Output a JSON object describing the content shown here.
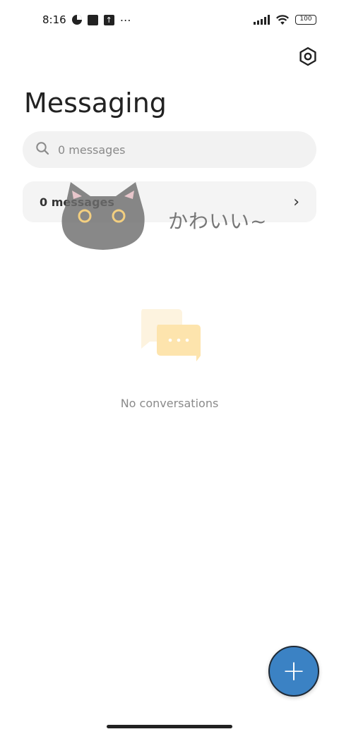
{
  "status_bar": {
    "time": "8:16",
    "battery": "100",
    "more_icon": "⋯"
  },
  "header": {
    "title": "Messaging",
    "settings_icon": "settings-hexagon-icon"
  },
  "search": {
    "placeholder": "0 messages"
  },
  "messages_row": {
    "label": "0 messages",
    "chevron": "›"
  },
  "sticker": {
    "text": "かわいい~"
  },
  "empty_state": {
    "text": "No conversations"
  },
  "fab": {
    "label": "+"
  },
  "colors": {
    "accent": "#3b82c4",
    "search_bg": "#f2f2f2",
    "empty_icon": "#fde7b5"
  }
}
